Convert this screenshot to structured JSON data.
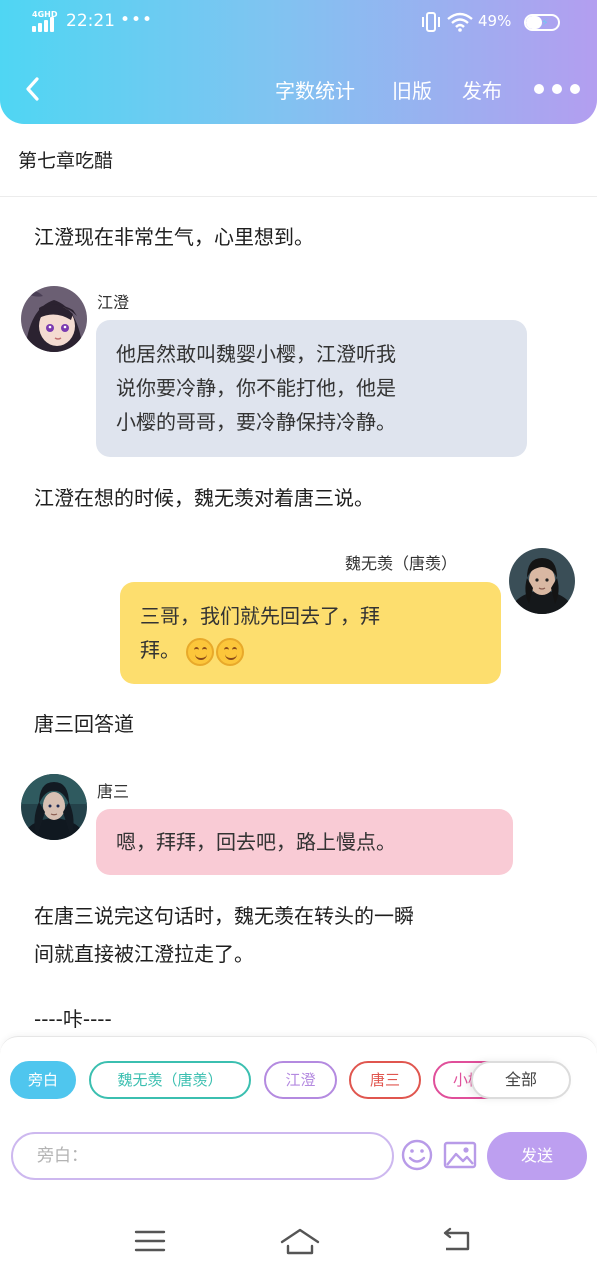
{
  "status_bar": {
    "network": "4GHD",
    "time": "22:21",
    "dots": "•••",
    "battery_percent": "49%",
    "battery_level": 0.49
  },
  "header": {
    "actions": [
      "字数统计",
      "旧版",
      "发布"
    ],
    "more_label": "more"
  },
  "chapter": {
    "title": "第七章吃醋"
  },
  "story": {
    "narration_1": "江澄现在非常生气，心里想到。",
    "message_1": {
      "speaker": "江澄",
      "text_lines": [
        "他居然敢叫魏婴小樱，江澄听我",
        "说你要冷静，你不能打他，他是",
        "小樱的哥哥，要冷静保持冷静。"
      ]
    },
    "narration_2": "江澄在想的时候，魏无羡对着唐三说。",
    "message_2": {
      "speaker": "魏无羡（唐羡）",
      "text_lines": [
        "三哥，我们就先回去了，拜",
        "拜。"
      ]
    },
    "narration_3": "唐三回答道",
    "message_3": {
      "speaker": "唐三",
      "text_lines": [
        "嗯，拜拜，回去吧，路上慢点。"
      ]
    },
    "narration_4_lines": [
      "在唐三说完这句话时，魏无羡在转头的一瞬",
      "间就直接被江澄拉走了。"
    ],
    "narration_5": "----咔----"
  },
  "role_chips": [
    {
      "label": "旁白",
      "color": "#4fc6ee",
      "active": true
    },
    {
      "label": "魏无羡（唐羡）",
      "color": "#3bbfb0",
      "active": false
    },
    {
      "label": "江澄",
      "color": "#b48ae0",
      "active": false
    },
    {
      "label": "唐三",
      "color": "#e0564f",
      "active": false
    },
    {
      "label": "小樱",
      "color": "#e04f9a",
      "active": false
    }
  ],
  "all_chip_label": "全部",
  "composer": {
    "placeholder": "旁白：",
    "send_label": "发送"
  },
  "colors": {
    "header_start": "#4fd6f3",
    "header_end": "#b39ef0",
    "accent": "#bd9ff0"
  }
}
